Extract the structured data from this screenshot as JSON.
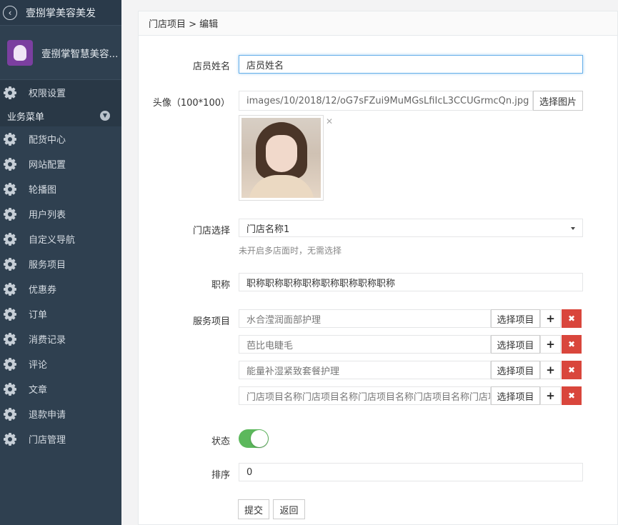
{
  "sidebar": {
    "top_title": "壹捌掌美容美发",
    "brand_name": "壹捌掌智慧美容...",
    "permission_label": "权限设置",
    "group_label": "业务菜单",
    "items": [
      {
        "label": "配货中心"
      },
      {
        "label": "网站配置"
      },
      {
        "label": "轮播图"
      },
      {
        "label": "用户列表"
      },
      {
        "label": "自定义导航"
      },
      {
        "label": "服务项目"
      },
      {
        "label": "优惠券"
      },
      {
        "label": "订单"
      },
      {
        "label": "消费记录"
      },
      {
        "label": "评论"
      },
      {
        "label": "文章"
      },
      {
        "label": "退款申请"
      },
      {
        "label": "门店管理"
      }
    ]
  },
  "panel": {
    "breadcrumb": "门店项目 > 编辑"
  },
  "form": {
    "staff_name": {
      "label": "店员姓名",
      "value": "店员姓名"
    },
    "avatar": {
      "label": "头像（100*100）",
      "value": "images/10/2018/12/oG7sFZui9MuMGsLfiIcL3CCUGrmcQn.jpg",
      "button": "选择图片",
      "remove": "✕"
    },
    "store": {
      "label": "门店选择",
      "value": "门店名称1",
      "hint": "未开启多店面时，无需选择"
    },
    "title": {
      "label": "职称",
      "value": "职称职称职称职称职称职称职称职称"
    },
    "services": {
      "label": "服务项目",
      "choose_label": "选择项目",
      "add_symbol": "+",
      "remove_symbol": "✖",
      "items": [
        {
          "value": "水合滢润面部护理"
        },
        {
          "value": "芭比电睫毛"
        },
        {
          "value": "能量补湿紧致套餐护理"
        },
        {
          "value": "门店项目名称门店项目名称门店项目名称门店项目名称门店项目"
        }
      ]
    },
    "status": {
      "label": "状态",
      "on": true
    },
    "sort": {
      "label": "排序",
      "value": "0"
    },
    "submit": "提交",
    "back": "返回"
  },
  "colors": {
    "sidebar_bg": "#2f4050",
    "switch_on": "#5cb85c",
    "danger": "#d9463c",
    "focus": "#66afe9"
  }
}
